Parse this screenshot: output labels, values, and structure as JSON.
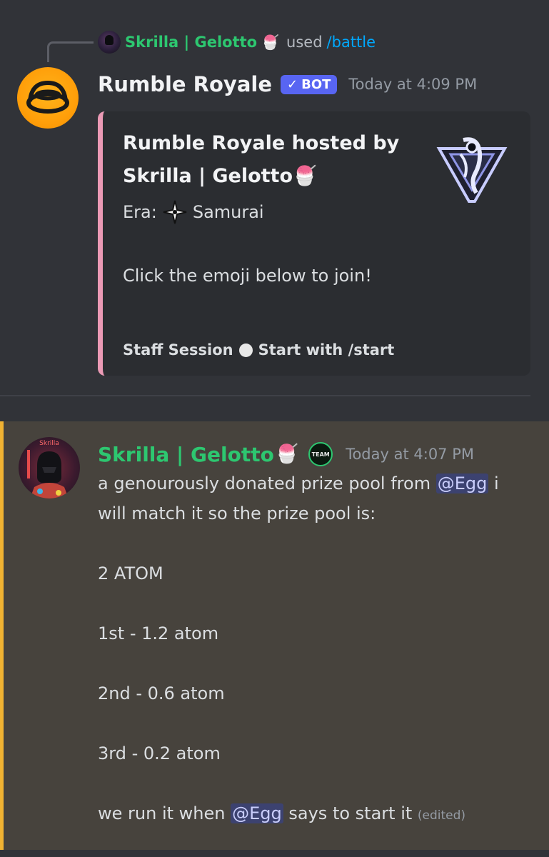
{
  "reply": {
    "user": "Skrilla | Gelotto",
    "used": "used",
    "command": "/battle"
  },
  "bot_message": {
    "author": "Rumble Royale",
    "badge": "BOT",
    "timestamp": "Today at 4:09 PM",
    "embed": {
      "accent_color": "#eb9ab5",
      "title": "Rumble Royale hosted by Skrilla | Gelotto",
      "era_label": "Era:",
      "era_value": "Samurai",
      "description": "Click the emoji below to join!",
      "footer_left": "Staff Session",
      "footer_right": "Start with /start"
    }
  },
  "user_message": {
    "author": "Skrilla | Gelotto",
    "badge": "TEAM",
    "timestamp": "Today at 4:07 PM",
    "highlight_color": "#f0b232",
    "lines": {
      "line1_pre": "a genourously donated prize pool from",
      "mention": "@Egg",
      "line1_post": "i will match it so the prize pool is:",
      "total": "2 ATOM",
      "first": "1st - 1.2 atom",
      "second": "2nd - 0.6 atom",
      "third": "3rd - 0.2 atom",
      "last_pre": "we run it when",
      "last_post": "says to start it",
      "edited": "(edited)"
    }
  }
}
